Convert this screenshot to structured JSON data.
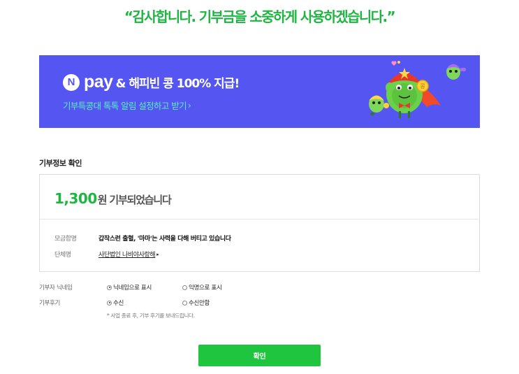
{
  "thanks_message": "“감사합니다. 기부금을 소중하게 사용하겠습니다.”",
  "banner": {
    "n_logo": "N",
    "pay_word": "pay",
    "title": "& 해피빈 콩 100% 지급!",
    "link_text": "기부특콩대 톡톡 알림 설정하고 받기",
    "link_chevron": "›",
    "background_color": "#5555f2"
  },
  "donation_info": {
    "section_title": "기부정보 확인",
    "amount": "1,300",
    "amount_suffix": "원 기부되었습니다",
    "rows": [
      {
        "label": "모금함명",
        "value": "갑작스런 출혈, '마마'는 사력을 다해 버티고 있습니다"
      },
      {
        "label": "단체명",
        "value": "사단법인 나비야사랑해",
        "marker": "▸"
      }
    ]
  },
  "options": [
    {
      "label": "기부자 닉네임",
      "choices": [
        {
          "text": "닉네임으로 표시",
          "selected": true
        },
        {
          "text": "익명으로 표시",
          "selected": false
        }
      ]
    },
    {
      "label": "기부후기",
      "choices": [
        {
          "text": "수신",
          "selected": true
        },
        {
          "text": "수신안함",
          "selected": false
        }
      ]
    }
  ],
  "note": "* 사업 종료 후, 기부 후기를 보내드립니다.",
  "confirm_label": "확인",
  "accent_color": "#1fb542"
}
